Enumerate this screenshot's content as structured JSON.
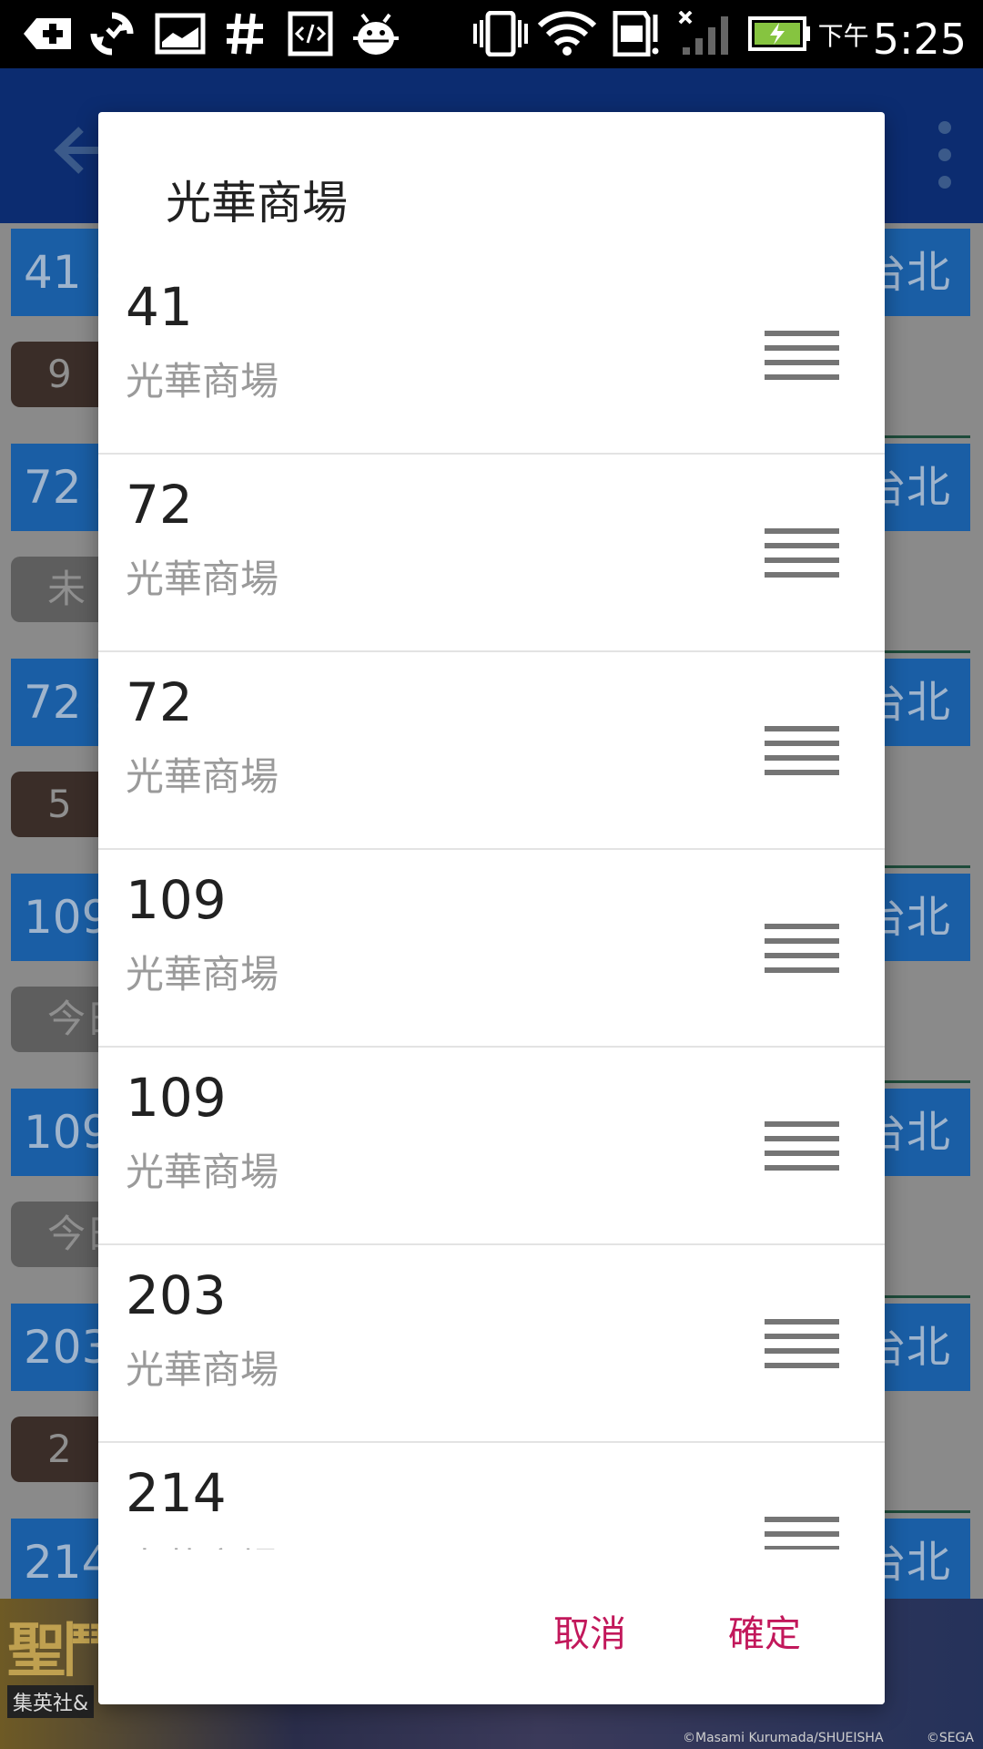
{
  "status_bar": {
    "ampm": "下午",
    "time": "5:25",
    "icons": [
      "add-notification-icon",
      "sync-icon",
      "image-icon",
      "hash-icon",
      "code-icon",
      "android-debug-icon",
      "vibrate-icon",
      "wifi-icon",
      "sd-card-icon",
      "signal-icon",
      "battery-charging-icon"
    ]
  },
  "background": {
    "rows": [
      {
        "route": "41 -",
        "dest": "台北",
        "badge": "9",
        "badge_style": "dark"
      },
      {
        "route": "72 -",
        "dest": "台北",
        "badge": "未",
        "badge_style": "grey"
      },
      {
        "route": "72 -",
        "dest": "台北",
        "badge": "5",
        "badge_style": "dark"
      },
      {
        "route": "109",
        "dest": "台北",
        "badge": "今日",
        "badge_style": "grey"
      },
      {
        "route": "109",
        "dest": "台北",
        "badge": "今日",
        "badge_style": "grey"
      },
      {
        "route": "203",
        "dest": "台北",
        "badge": "2",
        "badge_style": "dark"
      },
      {
        "route": "214",
        "dest": "台北",
        "badge": "",
        "badge_style": "dark"
      }
    ],
    "ad": {
      "title": "聖鬥",
      "subtitle": "集英社&",
      "copyright_left": "©Masami Kurumada/SHUEISHA",
      "copyright_right": "©SEGA"
    }
  },
  "dialog": {
    "title": "光華商場",
    "items": [
      {
        "number": "41",
        "stop": "光華商場"
      },
      {
        "number": "72",
        "stop": "光華商場"
      },
      {
        "number": "72",
        "stop": "光華商場"
      },
      {
        "number": "109",
        "stop": "光華商場"
      },
      {
        "number": "109",
        "stop": "光華商場"
      },
      {
        "number": "203",
        "stop": "光華商場"
      },
      {
        "number": "214",
        "stop": "光華商場"
      }
    ],
    "cancel_label": "取消",
    "ok_label": "確定"
  },
  "colors": {
    "accent": "#c2185b",
    "appbar": "#0c2c70",
    "route_blue": "#1a5ea5"
  }
}
